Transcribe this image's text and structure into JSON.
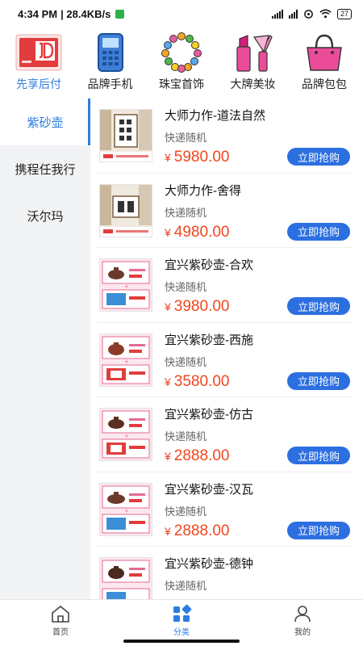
{
  "status_bar": {
    "time": "4:34 PM",
    "speed": "| 28.4KB/s",
    "battery": "27"
  },
  "top_categories": [
    {
      "label": "先享后付",
      "icon": "jd-card-icon",
      "active": true
    },
    {
      "label": "品牌手机",
      "icon": "phone-icon",
      "active": false
    },
    {
      "label": "珠宝首饰",
      "icon": "necklace-icon",
      "active": false
    },
    {
      "label": "大牌美妆",
      "icon": "lipstick-icon",
      "active": false
    },
    {
      "label": "品牌包包",
      "icon": "handbag-icon",
      "active": false
    }
  ],
  "sidebar": {
    "items": [
      {
        "label": "紫砂壶",
        "active": true
      },
      {
        "label": "携程任我行",
        "active": false
      },
      {
        "label": "沃尔玛",
        "active": false
      }
    ]
  },
  "products": [
    {
      "title": "大师力作-道法自然",
      "shipping": "快递随机",
      "currency": "¥",
      "price": "5980.00",
      "button": "立即抢购",
      "thumb": "calligraphy"
    },
    {
      "title": "大师力作-舍得",
      "shipping": "快递随机",
      "currency": "¥",
      "price": "4980.00",
      "button": "立即抢购",
      "thumb": "calligraphy"
    },
    {
      "title": "宜兴紫砂壶-合欢",
      "shipping": "快递随机",
      "currency": "¥",
      "price": "3980.00",
      "button": "立即抢购",
      "thumb": "teapot"
    },
    {
      "title": "宜兴紫砂壶-西施",
      "shipping": "快递随机",
      "currency": "¥",
      "price": "3580.00",
      "button": "立即抢购",
      "thumb": "teapot"
    },
    {
      "title": "宜兴紫砂壶-仿古",
      "shipping": "快递随机",
      "currency": "¥",
      "price": "2888.00",
      "button": "立即抢购",
      "thumb": "teapot"
    },
    {
      "title": "宜兴紫砂壶-汉瓦",
      "shipping": "快递随机",
      "currency": "¥",
      "price": "2888.00",
      "button": "立即抢购",
      "thumb": "teapot"
    },
    {
      "title": "宜兴紫砂壶-德钟",
      "shipping": "快递随机",
      "currency": "¥",
      "price": "",
      "button": "",
      "thumb": "teapot"
    }
  ],
  "bottom_nav": [
    {
      "label": "首页",
      "icon": "home-icon",
      "active": false
    },
    {
      "label": "分类",
      "icon": "category-icon",
      "active": true
    },
    {
      "label": "我的",
      "icon": "profile-icon",
      "active": false
    }
  ],
  "colors": {
    "accent": "#2d7de0",
    "button": "#2c6fe0",
    "price": "#f0461e",
    "sidebar_bg": "#f2f3f5"
  }
}
